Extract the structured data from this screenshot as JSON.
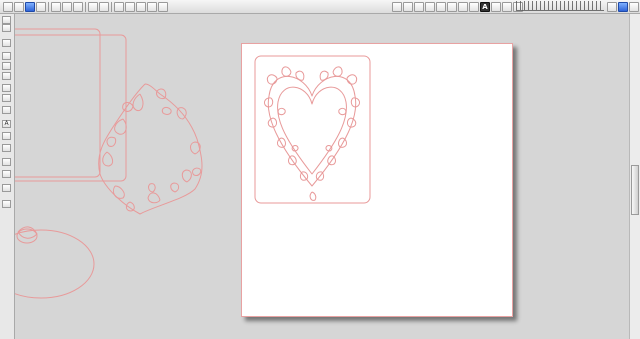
{
  "toolbar": {
    "left_group": [
      {
        "name": "new-document-icon"
      },
      {
        "name": "open-icon"
      },
      {
        "name": "save-icon"
      },
      {
        "name": "print-icon"
      },
      {
        "name": "cut-icon"
      },
      {
        "name": "copy-icon"
      },
      {
        "name": "paste-icon"
      },
      {
        "name": "undo-icon"
      },
      {
        "name": "redo-icon"
      },
      {
        "name": "zoom-in-icon"
      },
      {
        "name": "zoom-out-icon"
      },
      {
        "name": "zoom-fit-icon"
      },
      {
        "name": "zoom-page-icon"
      },
      {
        "name": "pan-icon"
      }
    ],
    "right_group": [
      {
        "name": "design-page-icon"
      },
      {
        "name": "grid-icon"
      },
      {
        "name": "registration-icon"
      },
      {
        "name": "cut-settings-icon"
      },
      {
        "name": "page-setup-icon"
      },
      {
        "name": "color-icon"
      },
      {
        "name": "fill-icon"
      },
      {
        "name": "line-icon"
      },
      {
        "name": "text-style-icon",
        "label": "A"
      },
      {
        "name": "offset-icon"
      },
      {
        "name": "replicate-icon"
      },
      {
        "name": "transform-icon"
      }
    ],
    "far_right": [
      {
        "name": "sketch-icon"
      },
      {
        "name": "library-icon"
      },
      {
        "name": "store-icon"
      },
      {
        "name": "send-to-cutter-icon"
      }
    ]
  },
  "left_tools": [
    {
      "name": "select-tool-icon"
    },
    {
      "name": "edit-points-icon"
    },
    {
      "name": "line-tool-icon"
    },
    {
      "name": "curve-tool-icon"
    },
    {
      "name": "rectangle-tool-icon"
    },
    {
      "name": "ellipse-tool-icon"
    },
    {
      "name": "polygon-tool-icon"
    },
    {
      "name": "freehand-tool-icon"
    },
    {
      "name": "smooth-tool-icon"
    },
    {
      "name": "text-tool-icon",
      "label": "A"
    },
    {
      "name": "knife-tool-icon"
    },
    {
      "name": "eraser-tool-icon"
    },
    {
      "name": "pan-tool-icon"
    },
    {
      "name": "zoom-tool-icon"
    },
    {
      "name": "trace-tool-icon"
    },
    {
      "name": "online-tool-icon"
    }
  ],
  "colors": {
    "cut_line": "#e89a9a",
    "page_border": "#e8a2a2",
    "canvas_bg": "#d6d6d6",
    "page_bg": "#ffffff"
  },
  "scroll": {
    "vertical_position": 0.55
  }
}
